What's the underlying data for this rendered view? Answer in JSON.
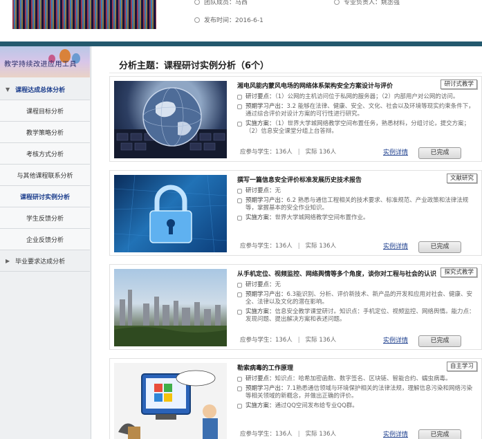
{
  "header": {
    "team_label": "团队成员：马西",
    "lead_label": "专业负责人：姚丞强",
    "publish_label": "发布时间：2016-6-1"
  },
  "sidebar": {
    "banner_title": "教学持续改进应用工具",
    "items": [
      {
        "label": "课程达成总体分析",
        "type": "parent",
        "expanded": true,
        "active": true
      },
      {
        "label": "课程目标分析"
      },
      {
        "label": "教学策略分析"
      },
      {
        "label": "考核方式分析"
      },
      {
        "label": "与其他课程联系分析"
      },
      {
        "label": "课程研讨实例分析",
        "active": true
      },
      {
        "label": "学生反馈分析"
      },
      {
        "label": "企业反馈分析"
      },
      {
        "label": "毕业要求达成分析",
        "type": "parent",
        "expanded": false
      }
    ]
  },
  "main": {
    "title": "分析主题：课程研讨实例分析（6个）",
    "labels": {
      "research": "研讨要点：",
      "expected": "预期学习产出：",
      "plan": "实施方案：",
      "participants": "应参与学生：",
      "actual": "实际",
      "detail": "实例详情",
      "done": "已完成"
    },
    "cards": [
      {
        "title": "湘电风能内蒙风电场的网络体系架构安全方案设计与评价",
        "tag": "研讨式教学",
        "research": "（1）公网的主机访问位于私网的服务器；（2）内部用户对公网的访问。",
        "expected": "3.2 能够在法律、健康、安全、文化、社会以及环境等现实约束条件下，通过综合评价对设计方案的可行性进行研究。",
        "plan": "（1）世界大学城网络教学空间布置任务，熟悉材料，分组讨论，提交方案；（2）信息安全课堂分组上台答辩。",
        "participants": "136人",
        "actual": "136人"
      },
      {
        "title": "撰写一篇信息安全评价标准发展历史技术报告",
        "tag": "文献研究",
        "research": "无",
        "expected": "6.2 熟悉与通信工程相关的技术要求、标准规范、产业政策和法律法规等，掌握基本的安全作业知识。",
        "plan": "世界大学城网络教学空间布置作业。",
        "participants": "136人",
        "actual": "136人"
      },
      {
        "title": "从手机定位、视频监控、网络舆情等多个角度，谈你对工程与社会的认识",
        "tag": "探究式教学",
        "research": "无",
        "expected": "6.3能识别、分析、评价新技术、新产品的开发和应用对社会、健康、安全、法律以及文化的潜在影响。",
        "plan": "信息安全教学课堂研讨。知识点：手机定位、视频监控、网络舆情。能力点：发现问题、提出解决方案和表述问题。",
        "participants": "136人",
        "actual": "136人"
      },
      {
        "title": "勒索病毒的工作原理",
        "tag": "自主学习",
        "research": "知识点：哈希加密函数、数字签名、区块链、智能合约、蠕虫病毒。",
        "expected": "7.1熟悉通信领域与环境保护相关的法律法规，理解信息污染和网络污染等相关领域的新概念，并做出正确的评价。",
        "plan": "通过QQ空间发布给专业QQ群。",
        "participants": "136人",
        "actual": "136人"
      }
    ]
  }
}
